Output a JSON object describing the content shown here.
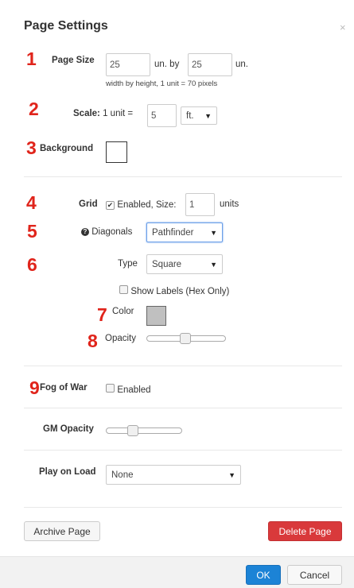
{
  "dialog": {
    "title": "Page Settings",
    "close_glyph": "×"
  },
  "markers": {
    "m1": "1",
    "m2": "2",
    "m3": "3",
    "m4": "4",
    "m5": "5",
    "m6": "6",
    "m7": "7",
    "m8": "8",
    "m9": "9"
  },
  "page_size": {
    "label": "Page Size",
    "width": "25",
    "by_label": "un. by",
    "height": "25",
    "unit_label": "un.",
    "hint": "width by height, 1 unit = 70 pixels"
  },
  "scale": {
    "label": "Scale:",
    "unit_text": "1 unit =",
    "value": "5",
    "unit_select": "ft."
  },
  "background": {
    "label": "Background",
    "color": "#ffffff"
  },
  "grid": {
    "label": "Grid",
    "enabled_text": "Enabled, Size:",
    "size": "1",
    "units_label": "units",
    "checked": true
  },
  "diagonals": {
    "label": "Diagonals",
    "value": "Pathfinder"
  },
  "type": {
    "label": "Type",
    "value": "Square"
  },
  "show_labels": {
    "label": "Show Labels (Hex Only)",
    "checked": false
  },
  "color": {
    "label": "Color",
    "swatch": "#c0c0c0"
  },
  "opacity": {
    "label": "Opacity",
    "value": 0.5
  },
  "fog_of_war": {
    "label": "Fog of War",
    "enabled_text": "Enabled",
    "checked": false
  },
  "gm_opacity": {
    "label": "GM Opacity",
    "value": 0.3
  },
  "play_on_load": {
    "label": "Play on Load",
    "value": "None"
  },
  "buttons": {
    "archive": "Archive Page",
    "delete": "Delete Page",
    "ok": "OK",
    "cancel": "Cancel"
  },
  "colors": {
    "marker": "#e0241b",
    "delete": "#d9393b",
    "ok": "#1c83d6"
  }
}
